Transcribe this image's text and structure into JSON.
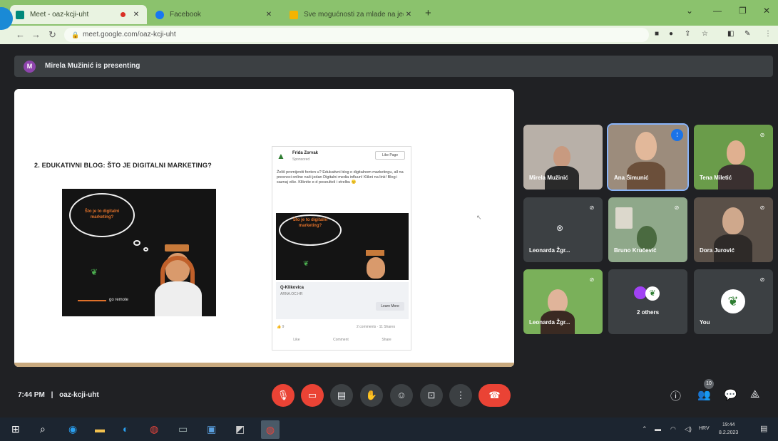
{
  "browser": {
    "tabs": [
      {
        "title": "Meet - oaz-kcji-uht",
        "active": true
      },
      {
        "title": "Facebook",
        "active": false
      },
      {
        "title": "Sve mogućnosti za mlade na jed...",
        "active": false
      }
    ],
    "url": "meet.google.com/oaz-kcji-uht",
    "accent": "#8bc26d"
  },
  "meet": {
    "presenter_initial": "M",
    "presenting_text": "Mirela Mužinić is presenting",
    "slide": {
      "title": "2. EDUKATIVNI BLOG: ŠTO JE DIGITALNI MARKETING?",
      "image_cloud_text": "Što je to digitalni marketing?",
      "image_link_text": "go remote",
      "post": {
        "page_name": "Frida Zorvak",
        "sponsored": "Sponsored",
        "like_label": "Like Page",
        "body": "Želiš promijeniti fonten u? Edukativni blog o digitalnom marketingu, all na presnoci online nači jedan Digitalni media influun! Klikni na link! Blog i saznaj više. Kliknite e-d poseulteli i strelbu 🙂",
        "image_cloud_text": "Što je to digitalni marketing?",
        "link_title": "Q-Klikovica",
        "link_domain": "ARNA.OC.HR",
        "learn_more": "Learn More",
        "reactions": "👍 9",
        "comments": "2 comments · 11 Shares",
        "actions": [
          "Like",
          "Comment",
          "Share"
        ]
      }
    },
    "participants": [
      {
        "name": "Mirela Mužinić",
        "muted": false,
        "speaking": false
      },
      {
        "name": "Ana Šimunić",
        "muted": false,
        "speaking": true
      },
      {
        "name": "Tena Miletić",
        "muted": true,
        "speaking": false
      },
      {
        "name": "Leonarda Žgr...",
        "muted": true,
        "speaking": false,
        "camera_off": true
      },
      {
        "name": "Bruno Kručević",
        "muted": true,
        "speaking": false
      },
      {
        "name": "Dora Jurović",
        "muted": true,
        "speaking": false
      },
      {
        "name": "Leonarda Žgr...",
        "muted": true,
        "speaking": false
      },
      {
        "name": "2 others",
        "muted": false,
        "speaking": false
      },
      {
        "name": "You",
        "muted": true,
        "speaking": false
      }
    ],
    "clock": "7:44 PM",
    "separator": "|",
    "meeting_code": "oaz-kcji-uht",
    "people_count": "10"
  },
  "taskbar": {
    "time": "19:44",
    "date": "8.2.2023",
    "lang": "HRV"
  }
}
